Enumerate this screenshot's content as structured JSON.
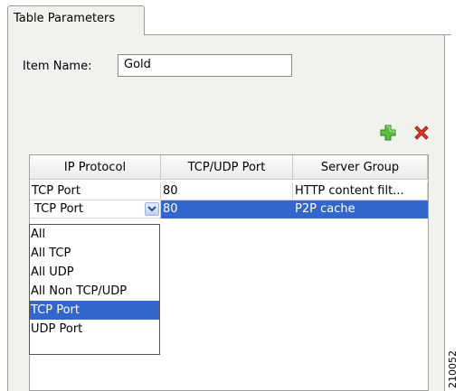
{
  "tab": {
    "label": "Table Parameters"
  },
  "item_name": {
    "label": "Item Name:",
    "value": "Gold"
  },
  "toolbar": {
    "add_icon": "plus-icon",
    "delete_icon": "x-icon",
    "add_color": "#4caf3a",
    "delete_color": "#e33b2e"
  },
  "table": {
    "columns": [
      "IP Protocol",
      "TCP/UDP Port",
      "Server Group"
    ],
    "rows": [
      [
        "TCP Port",
        "80",
        "HTTP content filt..."
      ],
      [
        "TCP Port",
        "80",
        "P2P cache"
      ]
    ],
    "selected_row_index": 1
  },
  "protocol_dropdown": {
    "options": [
      "All",
      "All TCP",
      "All UDP",
      "All Non TCP/UDP",
      "TCP Port",
      "UDP Port"
    ],
    "selected": "TCP Port"
  },
  "figure_id": "210052",
  "colors": {
    "selection": "#3366cc",
    "panel": "#f1f1ee"
  }
}
